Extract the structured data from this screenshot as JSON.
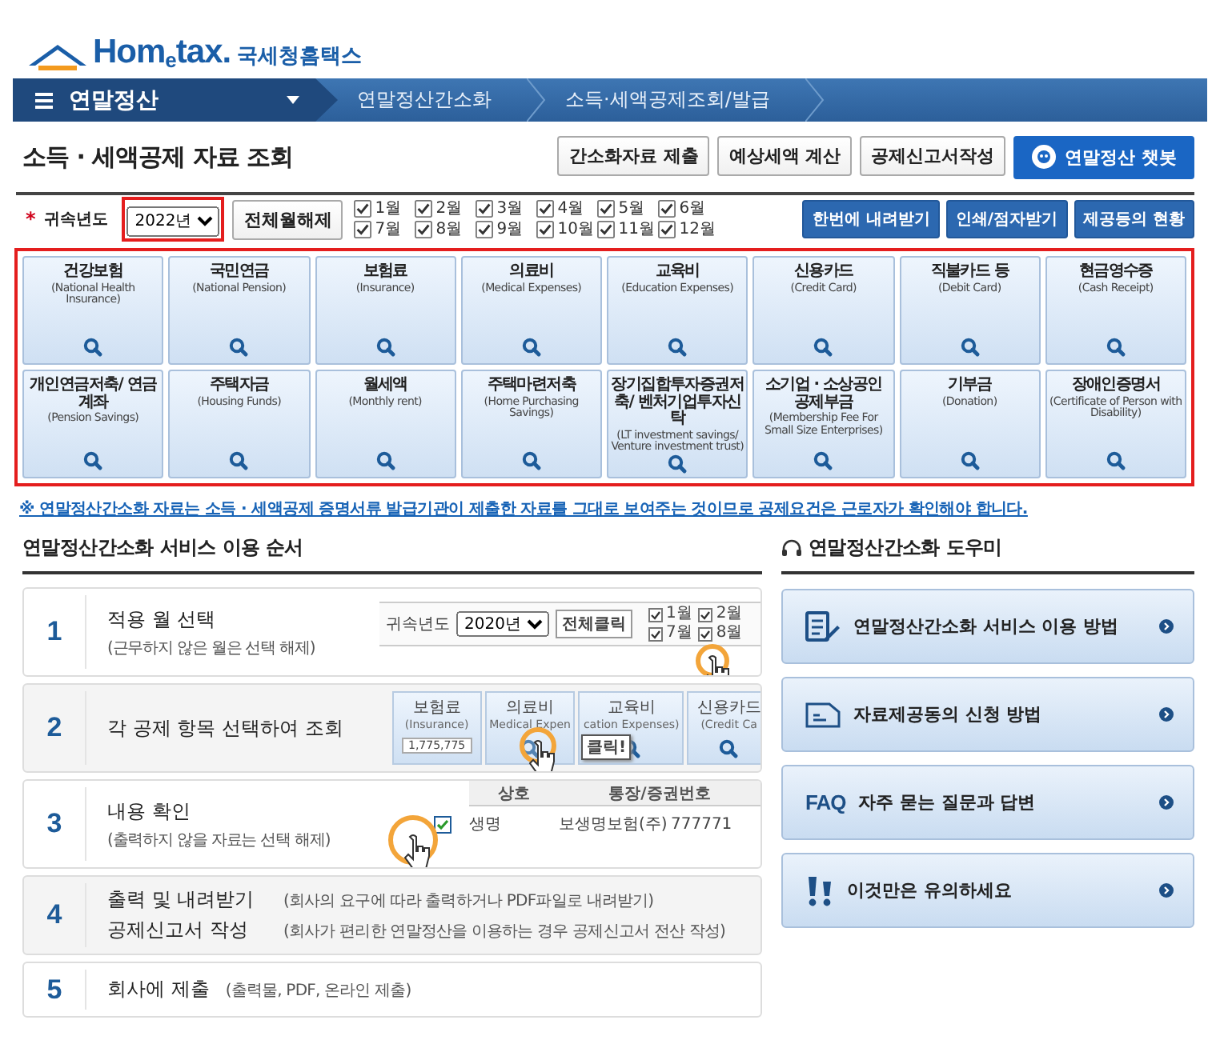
{
  "logo": {
    "brand": "Hom$_{e}$tax.",
    "tagline": "국세청홈택스"
  },
  "nav": {
    "menu": "연말정산",
    "breadcrumbs": [
      "연말정산간소화",
      "소득·세액공제조회/발급"
    ]
  },
  "page_title": "소득 · 세액공제 자료 조회",
  "top_buttons": [
    {
      "label": "간소화자료 제출",
      "kind": "plain"
    },
    {
      "label": "예상세액 계산",
      "kind": "plain"
    },
    {
      "label": "공제신고서작성",
      "kind": "plain"
    },
    {
      "label": "연말정산 챗봇",
      "kind": "chatbot"
    }
  ],
  "filter": {
    "required_mark": "*",
    "label": "귀속년도",
    "year": "2022년",
    "clear_button": "전체월해제",
    "months": [
      {
        "label": "1월",
        "checked": true
      },
      {
        "label": "2월",
        "checked": true
      },
      {
        "label": "3월",
        "checked": true
      },
      {
        "label": "4월",
        "checked": true
      },
      {
        "label": "5월",
        "checked": true
      },
      {
        "label": "6월",
        "checked": true
      },
      {
        "label": "7월",
        "checked": true
      },
      {
        "label": "8월",
        "checked": true
      },
      {
        "label": "9월",
        "checked": true
      },
      {
        "label": "10월",
        "checked": true
      },
      {
        "label": "11월",
        "checked": true
      },
      {
        "label": "12월",
        "checked": true
      }
    ],
    "buttons": [
      "한번에 내려받기",
      "인쇄/점자받기",
      "제공등의 현황"
    ]
  },
  "categories": [
    {
      "name": "건강보험",
      "english": "(National Health Insurance)"
    },
    {
      "name": "국민연금",
      "english": "(National Pension)"
    },
    {
      "name": "보험료",
      "english": "(Insurance)"
    },
    {
      "name": "의료비",
      "english": "(Medical Expenses)"
    },
    {
      "name": "교육비",
      "english": "(Education Expenses)"
    },
    {
      "name": "신용카드",
      "english": "(Credit Card)"
    },
    {
      "name": "직불카드 등",
      "english": "(Debit Card)"
    },
    {
      "name": "현금영수증",
      "english": "(Cash Receipt)"
    },
    {
      "name": "개인연금저축/ 연금계좌",
      "english": "(Pension Savings)"
    },
    {
      "name": "주택자금",
      "english": "(Housing Funds)"
    },
    {
      "name": "월세액",
      "english": "(Monthly rent)"
    },
    {
      "name": "주택마련저축",
      "english": "(Home Purchasing Savings)"
    },
    {
      "name": "장기집합투자증권저축/ 벤처기업투자신탁",
      "english": "(LT investment savings/ Venture investment trust)"
    },
    {
      "name": "소기업 · 소상공인 공제부금",
      "english": "(Membership Fee For Small Size Enterprises)"
    },
    {
      "name": "기부금",
      "english": "(Donation)"
    },
    {
      "name": "장애인증명서",
      "english": "(Certificate of Person with Disability)"
    }
  ],
  "notice": "※ 연말정산간소화 자료는 소득 · 세액공제 증명서류 발급기관이 제출한 자료를 그대로 보여주는 것이므로 공제요건은 근로자가 확인해야 합니다.",
  "steps_section": {
    "title": "연말정산간소화 서비스 이용 순서",
    "steps": [
      {
        "number": "1",
        "kind": "stacked",
        "lines": [
          {
            "title": "적용 월 선택",
            "note": "(근무하지 않은 월은 선택 해제)"
          }
        ],
        "illustration": {
          "kind": "months",
          "label": "귀속년도",
          "year": "2020년",
          "button": "전체클릭",
          "months": [
            {
              "label": "1월",
              "checked": true
            },
            {
              "label": "7월",
              "checked": true
            },
            {
              "label": "2월",
              "checked": true
            },
            {
              "label": "8월",
              "checked": true
            }
          ]
        }
      },
      {
        "number": "2",
        "kind": "stacked",
        "lines": [
          {
            "title": "각 공제 항목 선택하여 조회"
          }
        ],
        "illustration": {
          "kind": "tiles",
          "tooltip": "클릭!",
          "tiles": [
            {
              "name": "보험료",
              "english": "(Insurance)",
              "amount": "1,775,775"
            },
            {
              "name": "의료비",
              "english": "Medical Expen"
            },
            {
              "name": "교육비",
              "english": "cation Expenses)"
            },
            {
              "name": "신용카드",
              "english": "(Credit Ca"
            }
          ]
        }
      },
      {
        "number": "3",
        "kind": "stacked",
        "lines": [
          {
            "title": "내용 확인",
            "note": "(출력하지 않을 자료는 선택 해제)"
          }
        ],
        "illustration": {
          "kind": "table",
          "columns": [
            "상호",
            "통장/증권번호"
          ],
          "row": {
            "checked": true,
            "cells": [
              "생명",
              "보생명보험(주)",
              "777771"
            ]
          }
        }
      },
      {
        "number": "4",
        "kind": "inline",
        "lines": [
          {
            "title": "출력 및 내려받기",
            "note": "(회사의 요구에 따라 출력하거나 PDF파일로 내려받기)"
          },
          {
            "title": "공제신고서 작성",
            "note": "(회사가 편리한 연말정산을 이용하는 경우 공제신고서 전산 작성)"
          }
        ]
      },
      {
        "number": "5",
        "kind": "inline",
        "lines": [
          {
            "title": "회사에 제출",
            "note": "(출력물, PDF, 온라인 제출)"
          }
        ]
      }
    ]
  },
  "help": {
    "title": "연말정산간소화 도우미",
    "items": [
      {
        "kind": "edit",
        "label": "연말정산간소화 서비스 이용 방법"
      },
      {
        "kind": "form",
        "label": "자료제공동의 신청 방법"
      },
      {
        "kind": "faq",
        "badge": "FAQ",
        "label": "자주 묻는 질문과 답변"
      },
      {
        "kind": "alert",
        "label": "이것만은 유의하세요"
      }
    ]
  }
}
